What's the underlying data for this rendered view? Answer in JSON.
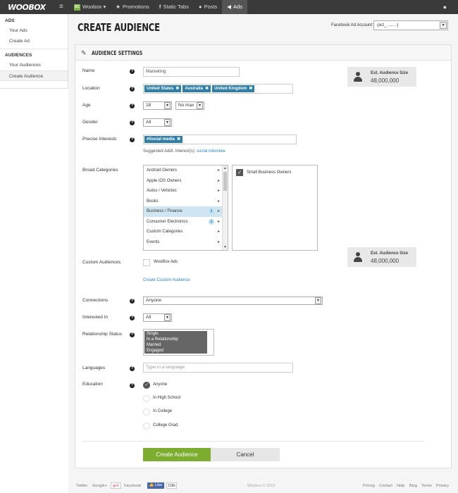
{
  "topbar": {
    "logo": "WOOBOX",
    "brand": {
      "badge": "SC",
      "label": "Woobox ▾"
    },
    "nav": [
      {
        "label": "Promotions"
      },
      {
        "label": "Static Tabs"
      },
      {
        "label": "Posts"
      },
      {
        "label": "Ads"
      }
    ]
  },
  "sidebar": {
    "sections": [
      {
        "heading": "ADS",
        "items": [
          "Your Ads",
          "Create Ad"
        ]
      },
      {
        "heading": "AUDIENCES",
        "items": [
          "Your Audiences",
          "Create Audience"
        ]
      }
    ]
  },
  "header": {
    "title": "CREATE AUDIENCE",
    "account_label": "Facebook Ad Account:",
    "account_value": "(act_  ..... ..)"
  },
  "panel": {
    "title": "AUDIENCE SETTINGS"
  },
  "form": {
    "name_label": "Name",
    "name_value": "Marketing",
    "location_label": "Location",
    "locations": [
      "United States",
      "Australia",
      "United Kingdom"
    ],
    "tag_remove": "✖",
    "age_label": "Age",
    "age_min": "18",
    "age_max": "No max",
    "gender_label": "Gender",
    "gender_value": "All",
    "interests_label": "Precise Interests",
    "interests": [
      "#Social media"
    ],
    "suggested_label": "Suggested Addt. Interest(s):",
    "suggested_value": "social interview",
    "broad_label": "Broad Categories",
    "broad_categories": [
      {
        "label": "Android Owners",
        "count": ""
      },
      {
        "label": "Apple iOS Owners",
        "count": ""
      },
      {
        "label": "Autos / Vehicles",
        "count": ""
      },
      {
        "label": "Books",
        "count": ""
      },
      {
        "label": "Business / Finance",
        "count": "1"
      },
      {
        "label": "Consumer Electronics",
        "count": "1"
      },
      {
        "label": "Custom Categories",
        "count": ""
      },
      {
        "label": "Events",
        "count": ""
      }
    ],
    "subcategory": "Small Business Owners",
    "custom_label": "Custom Audiences",
    "custom_option": "WooBox Ads",
    "create_custom_link": "Create Custom Audience",
    "connections_label": "Connections",
    "connections_value": "Anyone",
    "interested_label": "Interested In",
    "interested_value": "All",
    "relationship_label": "Relationship Status",
    "relationship_options": [
      "Single",
      "In a Relationship",
      "Married",
      "Engaged"
    ],
    "languages_label": "Languages",
    "languages_placeholder": "Type in a language",
    "education_label": "Education",
    "education_options": [
      "Anyone",
      "In High School",
      "In College",
      "College Grad"
    ],
    "education_selected": "Anyone"
  },
  "estimate": {
    "label": "Est. Audience Size",
    "value": "48,000,000"
  },
  "actions": {
    "create": "Create Audience",
    "cancel": "Cancel"
  },
  "footer": {
    "twitter": "Twitter",
    "googleplus": "Google+",
    "gplus_btn": "g+1",
    "facebook": "Facebook",
    "like": "Like",
    "like_count": "158k",
    "copyright": "Woobox © 2015",
    "links": [
      "Pricing",
      "Contact",
      "Help",
      "Blog",
      "Terms",
      "Privacy"
    ]
  },
  "colors": {
    "accent_green": "#7cad2f",
    "tag_blue": "#2f7ea7",
    "topbar": "#3a3a3a",
    "link": "#2a83c6"
  }
}
